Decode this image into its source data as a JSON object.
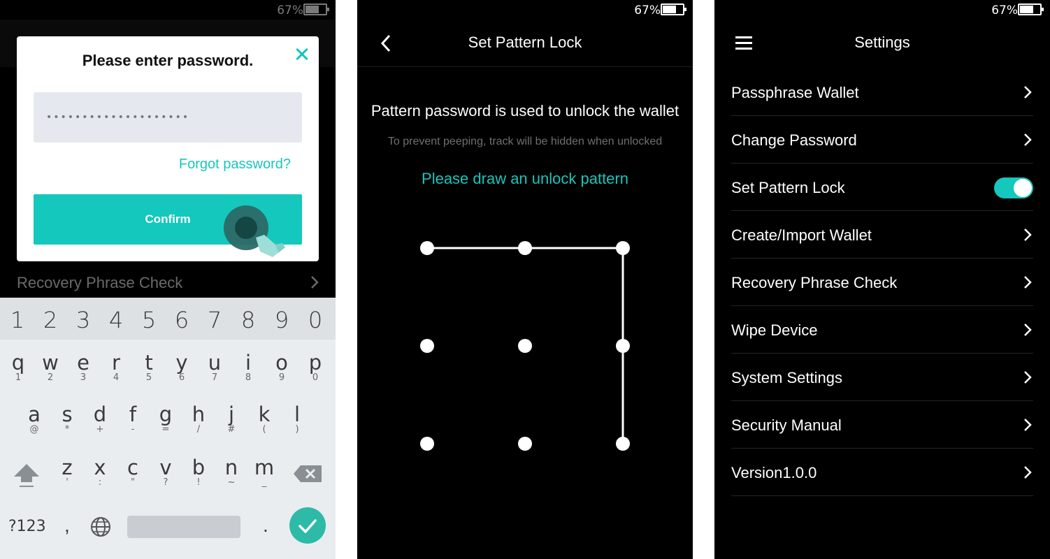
{
  "status": {
    "battery": "67%",
    "battery_level": 0.67
  },
  "panel1": {
    "dialog": {
      "title": "Please enter password.",
      "password_value": "••••••••••••••••••••",
      "forgot": "Forgot password?",
      "confirm": "Confirm"
    },
    "below_item": "Recovery Phrase Check",
    "keyboard": {
      "numbers": [
        "1",
        "2",
        "3",
        "4",
        "5",
        "6",
        "7",
        "8",
        "9",
        "0"
      ],
      "row1": [
        [
          "q",
          "1"
        ],
        [
          "w",
          "2"
        ],
        [
          "e",
          "3"
        ],
        [
          "r",
          "4"
        ],
        [
          "t",
          "5"
        ],
        [
          "y",
          "6"
        ],
        [
          "u",
          "7"
        ],
        [
          "i",
          "8"
        ],
        [
          "o",
          "9"
        ],
        [
          "p",
          "0"
        ]
      ],
      "row2": [
        [
          "a",
          "@"
        ],
        [
          "s",
          "*"
        ],
        [
          "d",
          "+"
        ],
        [
          "f",
          "-"
        ],
        [
          "g",
          "="
        ],
        [
          "h",
          "/"
        ],
        [
          "j",
          "#"
        ],
        [
          "k",
          "("
        ],
        [
          "l",
          ")"
        ]
      ],
      "row3": [
        [
          "z",
          "'"
        ],
        [
          "x",
          ":"
        ],
        [
          "c",
          "\""
        ],
        [
          "v",
          "?"
        ],
        [
          "b",
          "!"
        ],
        [
          "n",
          "~"
        ],
        [
          "m",
          "_"
        ]
      ],
      "sym": "?123",
      "comma": ",",
      "period": "."
    }
  },
  "panel2": {
    "title": "Set Pattern Lock",
    "heading": "Pattern password is used to unlock the wallet",
    "subheading": "To prevent peeping, track will be hidden when unlocked",
    "prompt": "Please draw an unlock pattern",
    "pattern": {
      "grid": "3x3",
      "path": [
        1,
        2,
        3,
        6,
        9
      ]
    }
  },
  "panel3": {
    "title": "Settings",
    "items": [
      {
        "label": "Passphrase Wallet",
        "control": "chevron"
      },
      {
        "label": "Change Password",
        "control": "chevron"
      },
      {
        "label": "Set Pattern Lock",
        "control": "toggle",
        "on": true
      },
      {
        "label": "Create/Import Wallet",
        "control": "chevron"
      },
      {
        "label": "Recovery Phrase Check",
        "control": "chevron"
      },
      {
        "label": "Wipe Device",
        "control": "chevron"
      },
      {
        "label": "System Settings",
        "control": "chevron"
      },
      {
        "label": "Security Manual",
        "control": "chevron"
      },
      {
        "label": "Version1.0.0",
        "control": "chevron"
      }
    ]
  },
  "colors": {
    "accent": "#14c8bd",
    "background": "#000000",
    "dialog": "#ffffff",
    "keyboard": "#e9edf0"
  }
}
